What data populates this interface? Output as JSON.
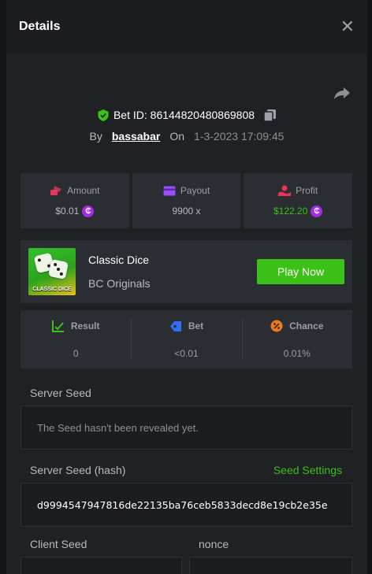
{
  "header": {
    "title": "Details"
  },
  "bet": {
    "id_label": "Bet ID: 86144820480869808",
    "by_label": "By",
    "username": "bassabar",
    "on_label": "On",
    "date": "1-3-2023 17:09:45"
  },
  "stats": {
    "amount": {
      "label": "Amount",
      "value": "$0.01"
    },
    "payout": {
      "label": "Payout",
      "value": "9900 x"
    },
    "profit": {
      "label": "Profit",
      "value": "$122.20"
    },
    "coin_symbol": "₵"
  },
  "game": {
    "name": "Classic Dice",
    "provider": "BC Originals",
    "thumb_label": "CLASSIC DICE",
    "play_label": "Play Now"
  },
  "result": {
    "result": {
      "label": "Result",
      "value": "0"
    },
    "bet": {
      "label": "Bet",
      "value": "<0.01"
    },
    "chance": {
      "label": "Chance",
      "value": "0.01%"
    }
  },
  "seeds": {
    "server_seed_label": "Server Seed",
    "server_seed_value": "The Seed hasn't been revealed yet.",
    "server_hash_label": "Server Seed (hash)",
    "seed_settings_label": "Seed Settings",
    "server_hash_value": "d9994547947816de22135ba76ceb5833decd8e19cb2e35e",
    "client_seed_label": "Client Seed",
    "nonce_label": "nonce"
  },
  "colors": {
    "accent_green": "#3bc117",
    "coin_purple": "#a32ce7",
    "amount_icon": "#e8355a",
    "payout_icon": "#9b4dff",
    "profit_icon": "#e8355a",
    "bet_icon": "#2e6ef7",
    "chance_icon": "#f07b18"
  }
}
